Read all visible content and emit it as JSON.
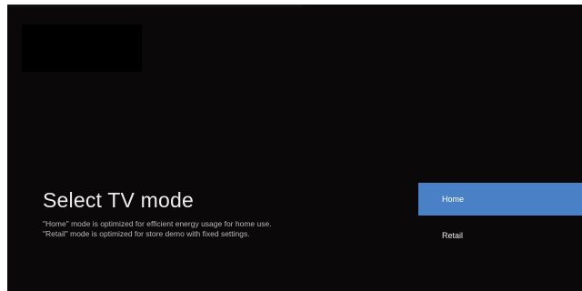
{
  "screen": {
    "title": "Select TV mode",
    "description_lines": [
      "\"Home\" mode is optimized for efficient energy usage for home use.",
      "\"Retail\" mode is optimized for store demo with fixed settings."
    ]
  },
  "modes": {
    "options": [
      "Home",
      "Retail"
    ],
    "selected": "Home"
  },
  "colors": {
    "background": "#0a0808",
    "selection": "#4a80c6",
    "text_primary": "#ececec",
    "text_secondary": "#b9b9b9"
  }
}
